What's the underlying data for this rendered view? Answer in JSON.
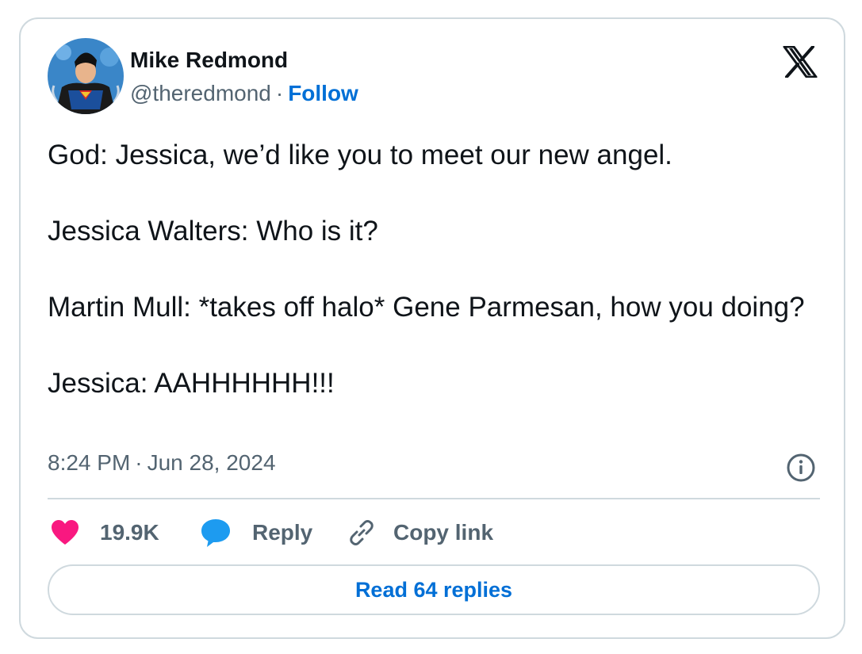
{
  "author": {
    "name": "Mike Redmond",
    "handle": "@theredmond",
    "separator": "·",
    "follow_label": "Follow"
  },
  "tweet": {
    "paragraphs": [
      "God: Jessica, we’d like you to meet our new angel.",
      "Jessica Walters: Who is it?",
      "Martin Mull: *takes off halo* Gene Parmesan, how you doing?",
      "Jessica: AAHHHHHH!!!"
    ],
    "time": "8:24 PM",
    "separator": "·",
    "date": "Jun 28, 2024"
  },
  "actions": {
    "like_count": "19.9K",
    "reply_label": "Reply",
    "copy_link_label": "Copy link"
  },
  "footer": {
    "read_replies_label": "Read 64 replies"
  },
  "icons": {
    "brand": "x-logo-icon",
    "info": "info-icon",
    "like": "heart-icon",
    "reply": "speech-bubble-icon",
    "copy": "link-icon"
  },
  "colors": {
    "follow_blue": "#006fd6",
    "like_pink": "#f91880",
    "reply_blue": "#1d9bf0",
    "muted_text": "#536471",
    "border": "#cfd9de"
  }
}
